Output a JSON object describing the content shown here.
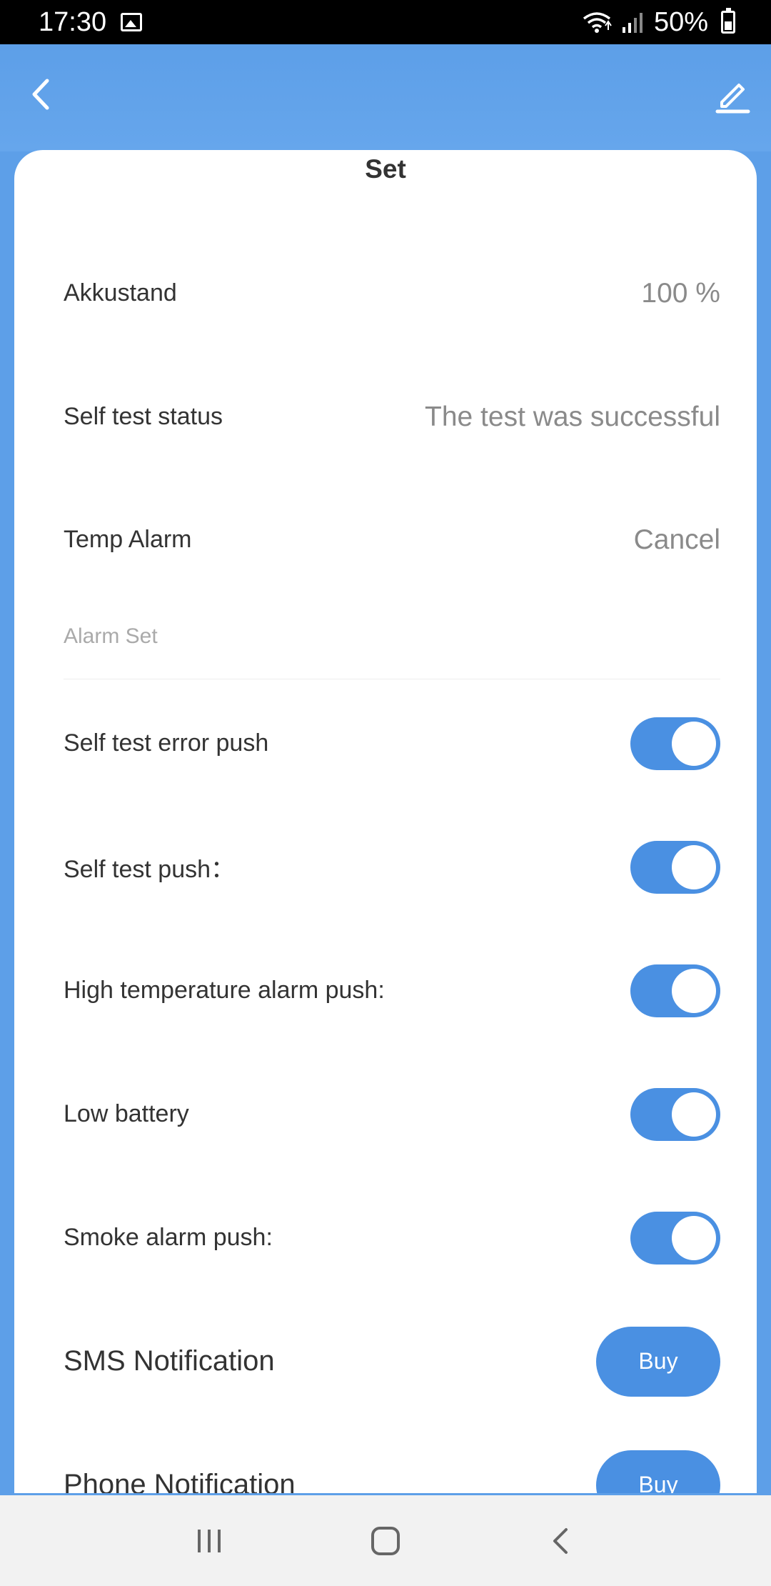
{
  "status_bar": {
    "time": "17:30",
    "battery_percent": "50%",
    "icons": [
      "gallery-icon",
      "wifi-icon",
      "signal-icon",
      "battery-icon"
    ]
  },
  "header": {
    "back_icon": "chevron-left-icon",
    "edit_icon": "pencil-icon",
    "title": "Set"
  },
  "info_rows": [
    {
      "label": "Akkustand",
      "value": "100 %"
    },
    {
      "label": "Self test status",
      "value": "The test was successful"
    },
    {
      "label": "Temp Alarm",
      "value": "Cancel"
    }
  ],
  "section": {
    "label": "Alarm Set"
  },
  "toggle_rows": [
    {
      "label": "Self test error push",
      "on": true
    },
    {
      "label": "Self test push：",
      "on": true
    },
    {
      "label": "High temperature alarm push:",
      "on": true
    },
    {
      "label": "Low battery",
      "on": true
    },
    {
      "label": "Smoke alarm push:",
      "on": true
    }
  ],
  "purchase_rows": [
    {
      "label": "SMS Notification",
      "button": "Buy"
    },
    {
      "label": "Phone Notification",
      "button": "Buy"
    }
  ],
  "colors": {
    "accent": "#4a90e2",
    "header_bg": "#5d9fe8",
    "value_text": "#8a8a8a"
  },
  "nav_bar": {
    "icons": [
      "recent-apps-icon",
      "home-icon",
      "back-icon"
    ]
  }
}
